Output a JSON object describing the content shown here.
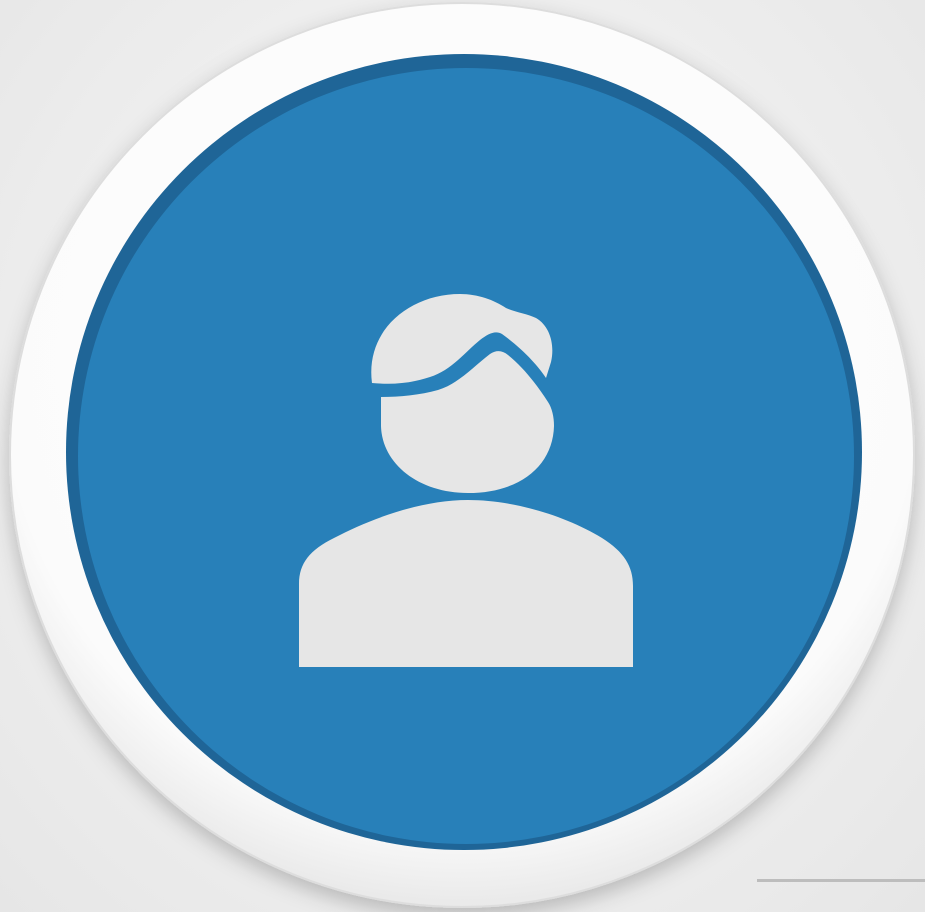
{
  "avatar": {
    "icon": "user-icon",
    "colors": {
      "background": "#eeeeee",
      "ring": "#ffffff",
      "disc": "#2880b9",
      "disc_edge": "#1f6597",
      "figure": "#e6e6e6"
    }
  }
}
